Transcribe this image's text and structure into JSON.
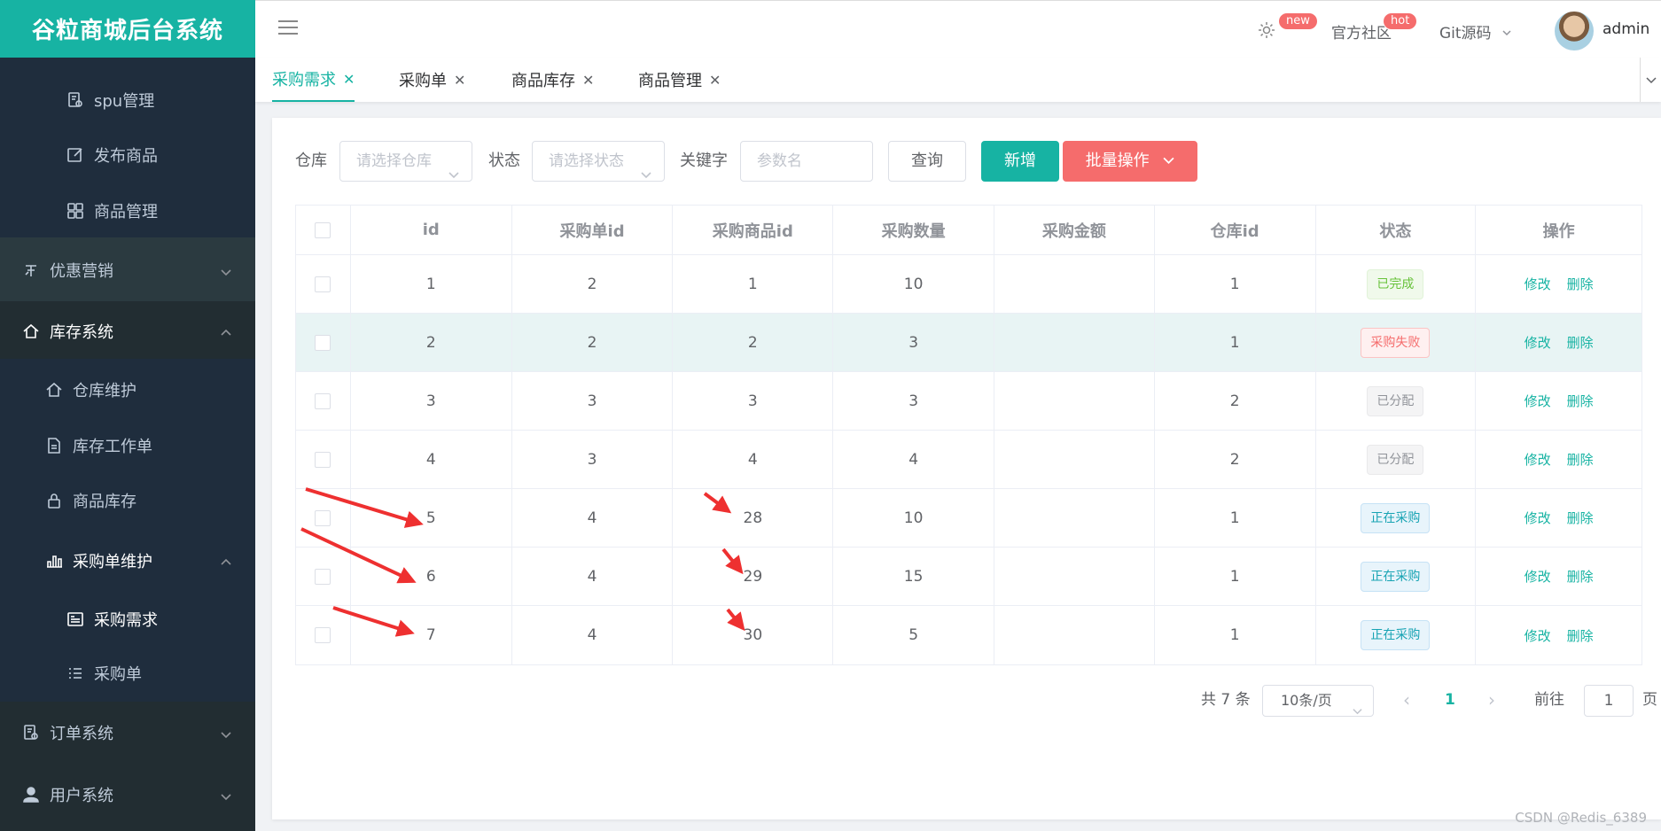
{
  "app": {
    "title": "谷粒商城后台系统"
  },
  "sidebar": {
    "items": [
      {
        "label": "spu管理",
        "icon": "spu-settings-icon"
      },
      {
        "label": "发布商品",
        "icon": "edit-icon"
      },
      {
        "label": "商品管理",
        "icon": "grid-icon"
      },
      {
        "label": "优惠营销",
        "icon": "coupon-icon"
      },
      {
        "label": "库存系统",
        "icon": "home-icon"
      },
      {
        "label": "仓库维护",
        "icon": "home-icon"
      },
      {
        "label": "库存工作单",
        "icon": "document-icon"
      },
      {
        "label": "商品库存",
        "icon": "lock-icon"
      },
      {
        "label": "采购单维护",
        "icon": "bar-chart-icon"
      },
      {
        "label": "采购需求",
        "icon": "list-box-icon"
      },
      {
        "label": "采购单",
        "icon": "list-icon"
      },
      {
        "label": "订单系统",
        "icon": "order-icon"
      },
      {
        "label": "用户系统",
        "icon": "user-icon"
      }
    ]
  },
  "header": {
    "settings_badge": "new",
    "community": "官方社区",
    "community_badge": "hot",
    "git": "Git源码",
    "user": "admin"
  },
  "tabs": [
    "采购需求",
    "采购单",
    "商品库存",
    "商品管理"
  ],
  "filters": {
    "warehouse_label": "仓库",
    "warehouse_placeholder": "请选择仓库",
    "status_label": "状态",
    "status_placeholder": "请选择状态",
    "keyword_label": "关键字",
    "keyword_placeholder": "参数名",
    "query_button": "查询",
    "add_button": "新增",
    "batch_button": "批量操作"
  },
  "table": {
    "columns": [
      "id",
      "采购单id",
      "采购商品id",
      "采购数量",
      "采购金额",
      "仓库id",
      "状态",
      "操作"
    ],
    "rows": [
      {
        "id": "1",
        "purchase_id": "2",
        "sku_id": "1",
        "num": "10",
        "amount": "",
        "ware_id": "1",
        "status": "已完成",
        "status_type": "success"
      },
      {
        "id": "2",
        "purchase_id": "2",
        "sku_id": "2",
        "num": "3",
        "amount": "",
        "ware_id": "1",
        "status": "采购失败",
        "status_type": "danger"
      },
      {
        "id": "3",
        "purchase_id": "3",
        "sku_id": "3",
        "num": "3",
        "amount": "",
        "ware_id": "2",
        "status": "已分配",
        "status_type": "info"
      },
      {
        "id": "4",
        "purchase_id": "3",
        "sku_id": "4",
        "num": "4",
        "amount": "",
        "ware_id": "2",
        "status": "已分配",
        "status_type": "info"
      },
      {
        "id": "5",
        "purchase_id": "4",
        "sku_id": "28",
        "num": "10",
        "amount": "",
        "ware_id": "1",
        "status": "正在采购",
        "status_type": "primary"
      },
      {
        "id": "6",
        "purchase_id": "4",
        "sku_id": "29",
        "num": "15",
        "amount": "",
        "ware_id": "1",
        "status": "正在采购",
        "status_type": "primary"
      },
      {
        "id": "7",
        "purchase_id": "4",
        "sku_id": "30",
        "num": "5",
        "amount": "",
        "ware_id": "1",
        "status": "正在采购",
        "status_type": "primary"
      }
    ],
    "edit_label": "修改",
    "delete_label": "删除"
  },
  "pagination": {
    "total": "共 7 条",
    "page_size": "10条/页",
    "current": "1",
    "goto_label": "前往",
    "goto_value": "1",
    "page_suffix": "页"
  },
  "watermark": "CSDN @Redis_6389",
  "colors": {
    "accent": "#17b3a3",
    "danger": "#f56c6c",
    "sidebar": "#222d32",
    "annotation_arrow": "#ee3030"
  }
}
